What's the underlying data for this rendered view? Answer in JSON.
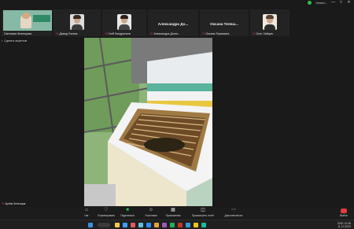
{
  "window": {
    "status_label": "Зелен...",
    "minimize": "—",
    "maximize": "□",
    "close": "✕"
  },
  "participants": [
    {
      "name": "Светлана Зеленцова",
      "muted": false,
      "kind": "screen"
    },
    {
      "name": "Давид Гнатюк",
      "muted": true,
      "kind": "photo"
    },
    {
      "name": "Глеб Кондратьев",
      "muted": true,
      "kind": "photo"
    },
    {
      "name": "Александра Догнн...",
      "display_name": "Александра До...",
      "muted": true,
      "kind": "name"
    },
    {
      "name": "Оксана Терешина",
      "display_name": "Оксана Телеш...",
      "muted": true,
      "kind": "name"
    },
    {
      "name": "Олег Зайцев",
      "muted": true,
      "kind": "photo"
    }
  ],
  "speaker_label": "Сделать акцентом",
  "bottom_name": "Артём Зеленцов",
  "toolbar": [
    {
      "label": "Чат",
      "icon": "chat-icon"
    },
    {
      "label": "Отреагировать",
      "icon": "react-icon"
    },
    {
      "label": "Поделиться",
      "icon": "share-icon"
    },
    {
      "label": "Участники",
      "icon": "participants-icon"
    },
    {
      "label": "Приложения",
      "icon": "apps-icon"
    },
    {
      "label": "Просмотреть отчёт",
      "icon": "report-icon"
    },
    {
      "label": "Дополнительно",
      "icon": "more-icon"
    }
  ],
  "leave_label": "Выйти",
  "tray": {
    "time": "12:48",
    "date": "11.10.2023",
    "lang": "ENG"
  }
}
